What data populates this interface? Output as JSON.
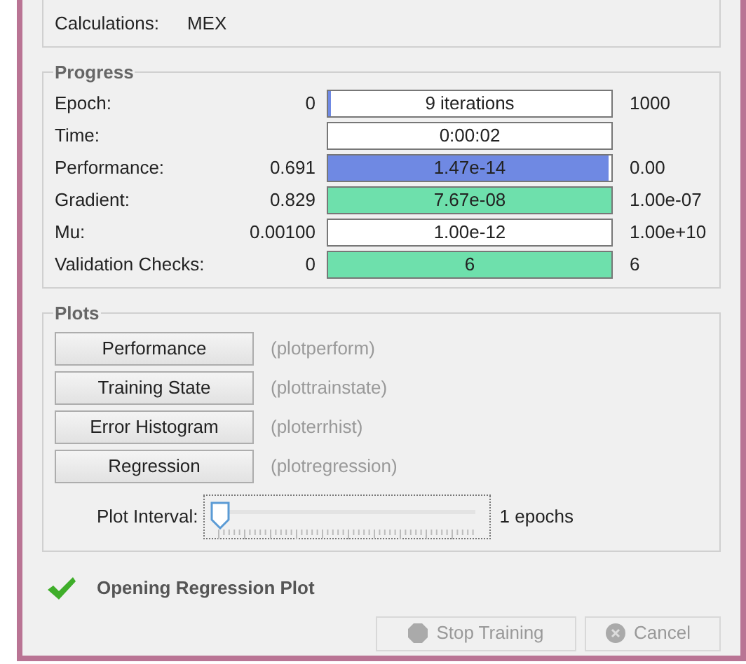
{
  "calculations": {
    "label": "Calculations:",
    "value": "MEX"
  },
  "progress": {
    "title": "Progress",
    "rows": [
      {
        "label": "Epoch:",
        "start": "0",
        "bar_text": "9 iterations",
        "end": "1000",
        "level": 0.01,
        "color": "#6f89e3"
      },
      {
        "label": "Time:",
        "bar_text": "0:00:02"
      },
      {
        "label": "Performance:",
        "start": "0.691",
        "bar_text": "1.47e-14",
        "end": "0.00",
        "level": 0.99,
        "color": "#6f89e3"
      },
      {
        "label": "Gradient:",
        "start": "0.829",
        "bar_text": "7.67e-08",
        "end": "1.00e-07",
        "level": 1,
        "color": "#6ee0ac"
      },
      {
        "label": "Mu:",
        "start": "0.00100",
        "bar_text": "1.00e-12",
        "end": "1.00e+10"
      },
      {
        "label": "Validation Checks:",
        "start": "0",
        "bar_text": "6",
        "end": "6",
        "level": 1,
        "color": "#6ee0ac"
      }
    ]
  },
  "plots": {
    "title": "Plots",
    "buttons": [
      {
        "label": "Performance",
        "function": "(plotperform)"
      },
      {
        "label": "Training State",
        "function": "(plottrainstate)"
      },
      {
        "label": "Error Histogram",
        "function": "(ploterrhist)"
      },
      {
        "label": "Regression",
        "function": "(plotregression)"
      }
    ],
    "interval": {
      "label": "Plot Interval:",
      "level": 0,
      "reading": "1 epochs"
    }
  },
  "status": {
    "text": "Opening Regression Plot"
  },
  "buttons": [
    {
      "label": "Stop Training",
      "kind": "stop",
      "disabled": true
    },
    {
      "label": "Cancel",
      "kind": "cancel",
      "disabled": true
    }
  ]
}
